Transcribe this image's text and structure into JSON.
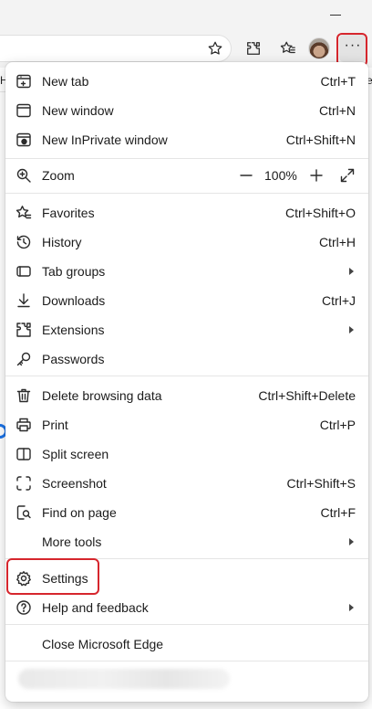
{
  "toolbar": {
    "more_label": "···"
  },
  "background": {
    "left_char": "H",
    "right_char": "e"
  },
  "menu": {
    "new_tab": {
      "label": "New tab",
      "shortcut": "Ctrl+T",
      "icon": "new-tab-icon"
    },
    "new_window": {
      "label": "New window",
      "shortcut": "Ctrl+N",
      "icon": "window-icon"
    },
    "new_inprivate": {
      "label": "New InPrivate window",
      "shortcut": "Ctrl+Shift+N",
      "icon": "inprivate-icon"
    },
    "zoom": {
      "label": "Zoom",
      "value": "100%",
      "icon": "zoom-icon"
    },
    "favorites": {
      "label": "Favorites",
      "shortcut": "Ctrl+Shift+O",
      "icon": "favorites-icon"
    },
    "history": {
      "label": "History",
      "shortcut": "Ctrl+H",
      "icon": "history-icon"
    },
    "tab_groups": {
      "label": "Tab groups",
      "icon": "tab-groups-icon"
    },
    "downloads": {
      "label": "Downloads",
      "shortcut": "Ctrl+J",
      "icon": "download-icon"
    },
    "extensions": {
      "label": "Extensions",
      "icon": "extensions-icon"
    },
    "passwords": {
      "label": "Passwords",
      "icon": "key-icon"
    },
    "delete_browsing": {
      "label": "Delete browsing data",
      "shortcut": "Ctrl+Shift+Delete",
      "icon": "trash-icon"
    },
    "print": {
      "label": "Print",
      "shortcut": "Ctrl+P",
      "icon": "print-icon"
    },
    "split_screen": {
      "label": "Split screen",
      "icon": "split-screen-icon"
    },
    "screenshot": {
      "label": "Screenshot",
      "shortcut": "Ctrl+Shift+S",
      "icon": "screenshot-icon"
    },
    "find_on_page": {
      "label": "Find on page",
      "shortcut": "Ctrl+F",
      "icon": "find-icon"
    },
    "more_tools": {
      "label": "More tools"
    },
    "settings": {
      "label": "Settings",
      "icon": "gear-icon"
    },
    "help": {
      "label": "Help and feedback",
      "icon": "help-icon"
    },
    "close_edge": {
      "label": "Close Microsoft Edge"
    }
  },
  "colors": {
    "highlight": "#d6262d",
    "accent": "#1a73e8"
  }
}
